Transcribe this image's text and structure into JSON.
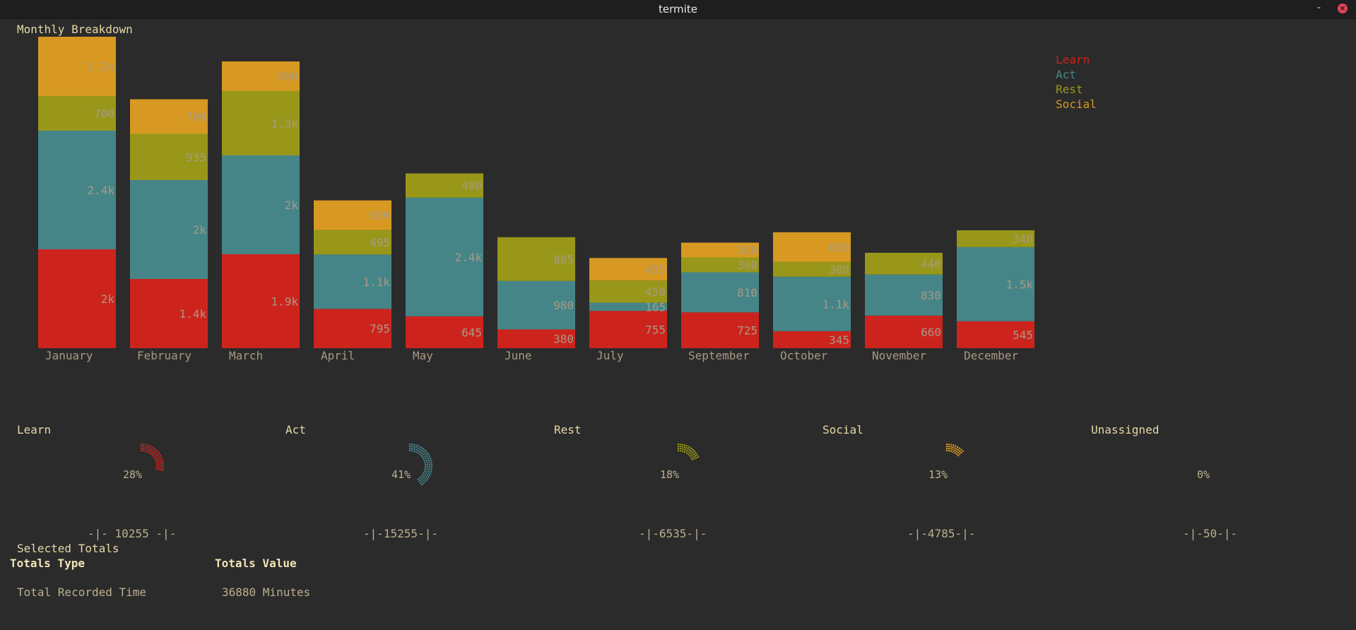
{
  "window": {
    "title": "termite",
    "minimize_label": "-",
    "close_label": "×"
  },
  "chart_title": "Monthly Breakdown",
  "colors": {
    "learn": "#cc241d",
    "act": "#458588",
    "rest": "#98971a",
    "social": "#d79921",
    "label": "#a89984"
  },
  "legend": [
    {
      "name": "Learn",
      "color": "#cc241d"
    },
    {
      "name": "Act",
      "color": "#458588"
    },
    {
      "name": "Rest",
      "color": "#98971a"
    },
    {
      "name": "Social",
      "color": "#d79921"
    }
  ],
  "chart_data": {
    "type": "bar",
    "stacked": true,
    "categories": [
      "January",
      "February",
      "March",
      "April",
      "May",
      "June",
      "July",
      "September",
      "October",
      "November",
      "December"
    ],
    "series": [
      {
        "name": "Learn",
        "color": "#cc241d",
        "values": [
          2000,
          1400,
          1900,
          795,
          645,
          380,
          755,
          725,
          345,
          660,
          545
        ],
        "labels": [
          "2k",
          "1.4k",
          "1.9k",
          "795",
          "645",
          "380",
          "755",
          "725",
          "345",
          "660",
          "545"
        ]
      },
      {
        "name": "Act",
        "color": "#458588",
        "values": [
          2400,
          2000,
          2000,
          1100,
          2400,
          980,
          165,
          810,
          1100,
          830,
          1500
        ],
        "labels": [
          "2.4k",
          "2k",
          "2k",
          "1.1k",
          "2.4k",
          "980",
          "165",
          "810",
          "1.1k",
          "830",
          "1.5k"
        ]
      },
      {
        "name": "Rest",
        "color": "#98971a",
        "values": [
          700,
          935,
          1300,
          495,
          490,
          885,
          450,
          300,
          300,
          440,
          340
        ],
        "labels": [
          "700",
          "935",
          "1.3k",
          "495",
          "490",
          "885",
          "450",
          "300",
          "300",
          "440",
          "340"
        ]
      },
      {
        "name": "Social",
        "color": "#d79921",
        "values": [
          1200,
          700,
          600,
          600,
          0,
          0,
          455,
          300,
          600,
          0,
          0
        ],
        "labels": [
          "1.2k",
          "700",
          "600",
          "600",
          "",
          "",
          "455",
          "300",
          "600",
          "",
          ""
        ]
      }
    ],
    "legend_position": "top-right",
    "grid": false
  },
  "categories_summary": [
    {
      "name": "Learn",
      "percent": 28,
      "percent_label": "28%",
      "total": "-|- 10255 -|-",
      "color": "#cc241d"
    },
    {
      "name": "Act",
      "percent": 41,
      "percent_label": "41%",
      "total": "-|-15255-|-",
      "color": "#458588"
    },
    {
      "name": "Rest",
      "percent": 18,
      "percent_label": "18%",
      "total": "-|-6535-|-",
      "color": "#98971a"
    },
    {
      "name": "Social",
      "percent": 13,
      "percent_label": "13%",
      "total": "-|-4785-|-",
      "color": "#d79921"
    },
    {
      "name": "Unassigned",
      "percent": 0,
      "percent_label": "0%",
      "total": "-|-50-|-",
      "color": "#bcb08f"
    }
  ],
  "selected_totals": {
    "title": "Selected Totals",
    "headers": {
      "type": "Totals Type",
      "value": "Totals Value"
    },
    "rows": [
      {
        "type": "Total Recorded Time",
        "value": "36880 Minutes"
      }
    ]
  }
}
